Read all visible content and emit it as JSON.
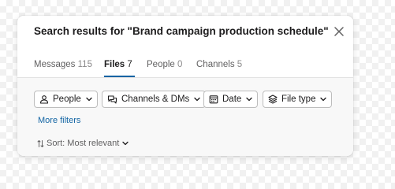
{
  "header": {
    "title": "Search results for \"Brand campaign production schedule\"",
    "close_icon": "close-icon"
  },
  "tabs": [
    {
      "label": "Messages",
      "count": "115",
      "active": false
    },
    {
      "label": "Files",
      "count": "7",
      "active": true
    },
    {
      "label": "People",
      "count": "0",
      "active": false
    },
    {
      "label": "Channels",
      "count": "5",
      "active": false
    }
  ],
  "filters": {
    "chips": [
      {
        "label": "People",
        "icon": "person-icon"
      },
      {
        "label": "Channels & DMs",
        "icon": "chat-bubbles-icon"
      },
      {
        "label": "Date",
        "icon": "calendar-icon"
      },
      {
        "label": "File type",
        "icon": "layers-icon"
      }
    ],
    "more_filters": "More filters",
    "sort_label": "Sort: Most relevant"
  },
  "colors": {
    "accent": "#1264a3",
    "text": "#1d1c1d",
    "muted": "#616061",
    "border": "#bdbdbd"
  }
}
